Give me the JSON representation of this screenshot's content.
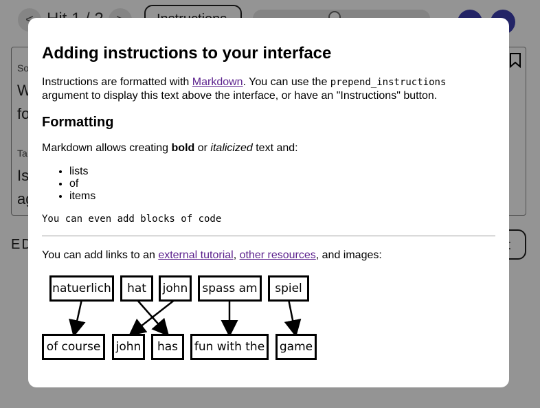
{
  "background": {
    "nav": {
      "prev": "<",
      "next": ">",
      "hit_label": "Hit 1 / 2"
    },
    "instructions_button": "Instructions",
    "card": {
      "label1": "So",
      "text1a": "W",
      "text1b": "fo",
      "label2": "Ta",
      "text2a": "Is",
      "text2b": "ag"
    },
    "edit_label": "ED",
    "edit_button": "dit"
  },
  "modal": {
    "title": "Adding instructions to your interface",
    "intro_pre": "Instructions are formatted with ",
    "intro_link": "Markdown",
    "intro_mid": ". You can use the ",
    "intro_code": "prepend_instructions",
    "intro_post": " argument to display this text above the interface, or have an \"Instructions\" button.",
    "formatting_heading": "Formatting",
    "fmt_pre": "Markdown allows creating ",
    "fmt_bold": "bold",
    "fmt_mid": " or ",
    "fmt_italic": "italicized",
    "fmt_post": " text and:",
    "list_items": [
      "lists",
      "of",
      "items"
    ],
    "code_block": "You can even add blocks of code",
    "links_pre": "You can add links to an ",
    "link1": "external tutorial",
    "links_sep": ", ",
    "link2": "other resources",
    "links_post": ", and images:",
    "diagram": {
      "source_words": [
        "natuerlich",
        "hat",
        "john",
        "spass am",
        "spiel"
      ],
      "target_words": [
        "of course",
        "john",
        "has",
        "fun with the",
        "game"
      ]
    }
  }
}
